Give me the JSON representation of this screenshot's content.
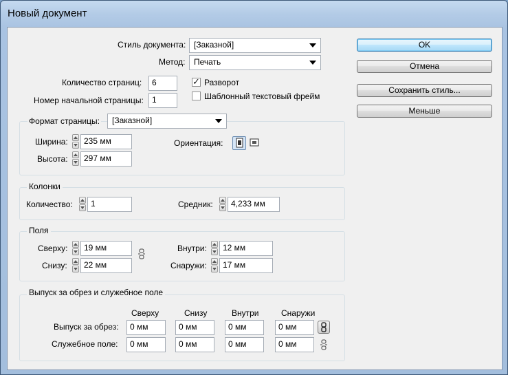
{
  "window": {
    "title": "Новый документ"
  },
  "top": {
    "doc_style_label": "Стиль документа:",
    "doc_style_value": "[Заказной]",
    "method_label": "Метод:",
    "method_value": "Печать",
    "pages_count_label": "Количество страниц:",
    "pages_count_value": "6",
    "start_page_label": "Номер начальной страницы:",
    "start_page_value": "1",
    "facing_label": "Разворот",
    "facing_checked": true,
    "master_text_label": "Шаблонный текстовый фрейм",
    "master_text_checked": false
  },
  "buttons": {
    "ok": "OK",
    "cancel": "Отмена",
    "save_style": "Сохранить стиль...",
    "less": "Меньше"
  },
  "page_format": {
    "label": "Формат страницы:",
    "value": "[Заказной]",
    "width_label": "Ширина:",
    "width_value": "235 мм",
    "height_label": "Высота:",
    "height_value": "297 мм",
    "orientation_label": "Ориентация:",
    "orientation_icons": [
      "portrait-icon",
      "landscape-icon"
    ]
  },
  "columns": {
    "title": "Колонки",
    "count_label": "Количество:",
    "count_value": "1",
    "gutter_label": "Средник:",
    "gutter_value": "4,233 мм"
  },
  "margins": {
    "title": "Поля",
    "top_label": "Сверху:",
    "top_value": "19 мм",
    "bottom_label": "Снизу:",
    "bottom_value": "22 мм",
    "inside_label": "Внутри:",
    "inside_value": "12 мм",
    "outside_label": "Снаружи:",
    "outside_value": "17 мм"
  },
  "bleed": {
    "title": "Выпуск за обрез и служебное поле",
    "headers": [
      "Сверху",
      "Снизу",
      "Внутри",
      "Снаружи"
    ],
    "bleed_label": "Выпуск за обрез:",
    "bleed_values": [
      "0 мм",
      "0 мм",
      "0 мм",
      "0 мм"
    ],
    "slug_label": "Служебное поле:",
    "slug_values": [
      "0 мм",
      "0 мм",
      "0 мм",
      "0 мм"
    ]
  }
}
